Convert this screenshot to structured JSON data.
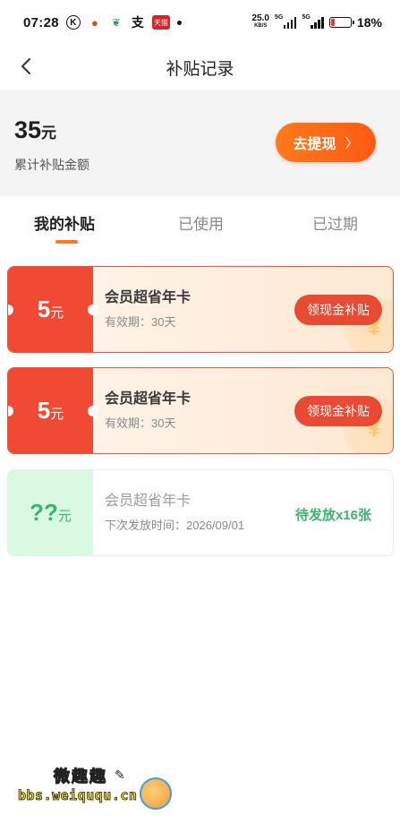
{
  "status_bar": {
    "time": "07:28",
    "icons": [
      "k-icon",
      "weibo-icon",
      "leaf-icon",
      "zhi-icon",
      "tmall-icon",
      "dot-icon"
    ],
    "tmall_text": "天猫",
    "net_speed": "25.0",
    "net_unit": "KB/S",
    "signal_1": "5G",
    "signal_2": "5G",
    "battery_level": 0.18,
    "battery_text": "18%"
  },
  "nav": {
    "title": "补贴记录"
  },
  "summary": {
    "amount": "35",
    "unit": "元",
    "label": "累计补贴金额",
    "withdraw_label": "去提现",
    "withdraw_chevron": "〉"
  },
  "tabs": [
    {
      "label": "我的补贴",
      "active": true
    },
    {
      "label": "已使用",
      "active": false
    },
    {
      "label": "已过期",
      "active": false
    }
  ],
  "coupons": [
    {
      "value": "5",
      "unit": "元",
      "title": "会员超省年卡",
      "subtitle": "有效期：30天",
      "action": "领现金补贴"
    },
    {
      "value": "5",
      "unit": "元",
      "title": "会员超省年卡",
      "subtitle": "有效期：30天",
      "action": "领现金补贴"
    },
    {
      "value": "??",
      "unit": "元",
      "title": "会员超省年卡",
      "subtitle": "下次发放时间：2026/09/01",
      "status": "待发放x16张"
    }
  ],
  "watermark": {
    "top": "微趣趣",
    "mark": "✎",
    "url": "bbs.weiququ.cn"
  },
  "colors": {
    "accent": "#ff6a14",
    "coupon_red": "#f04a35",
    "pending_green": "#3bb46a",
    "summary_bg": "#f4f4f5"
  }
}
